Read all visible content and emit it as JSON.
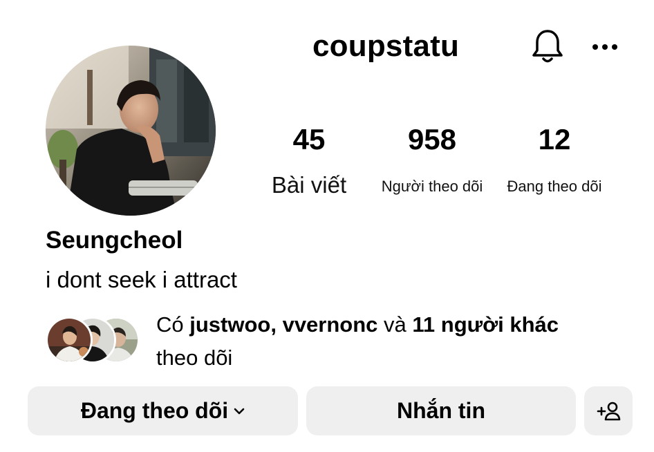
{
  "profile": {
    "username": "coupstatu",
    "display_name": "Seungcheol",
    "bio": "i dont seek i attract"
  },
  "stats": {
    "posts": {
      "value": "45",
      "label": "Bài viết"
    },
    "followers": {
      "value": "958",
      "label": "Người theo dõi"
    },
    "following": {
      "value": "12",
      "label": "Đang theo dõi"
    }
  },
  "mutual": {
    "prefix": "Có ",
    "names": "justwoo, vvernonc",
    "connector": " và ",
    "others": "11 người khác",
    "suffix": "theo dõi"
  },
  "buttons": {
    "following_label": "Đang theo dõi",
    "message_label": "Nhắn tin"
  },
  "icons": {
    "header": [
      "bell-icon",
      "more-icon"
    ],
    "follow_dropdown": "chevron-down-icon",
    "add_user": "add-user-icon"
  },
  "colors": {
    "button_bg": "#efefef",
    "text": "#000000"
  }
}
